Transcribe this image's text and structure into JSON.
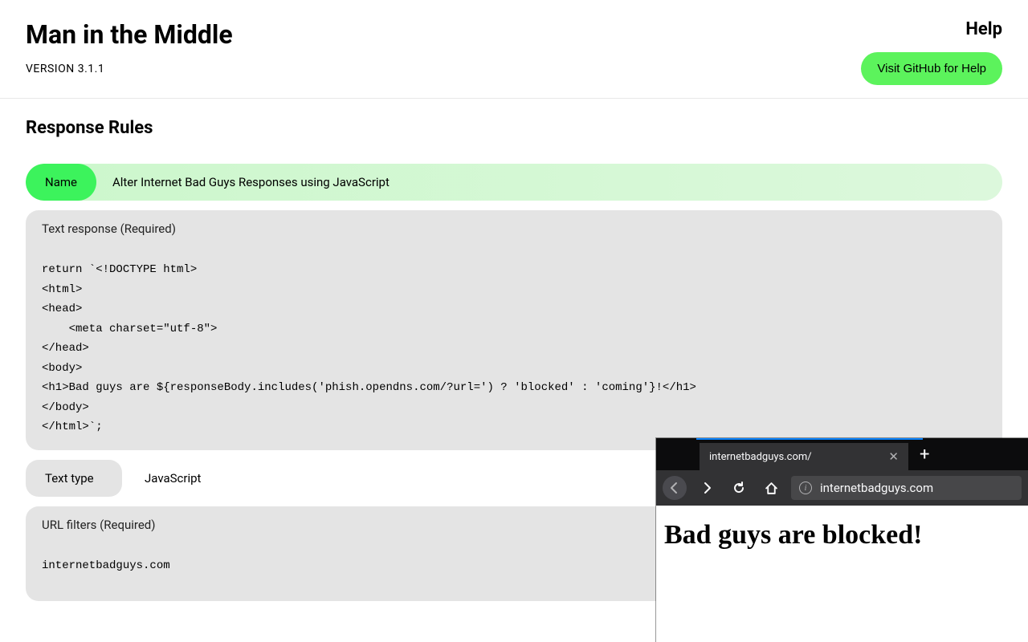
{
  "header": {
    "title": "Man in the Middle",
    "version": "VERSION 3.1.1",
    "help_title": "Help",
    "github_button": "Visit GitHub for Help"
  },
  "section": {
    "title": "Response Rules"
  },
  "rule": {
    "name_label": "Name",
    "name_value": "Alter Internet Bad Guys Responses using JavaScript",
    "text_response_label": "Text response (Required)",
    "text_response_value": "return `<!DOCTYPE html>\n<html>\n<head>\n    <meta charset=\"utf-8\">\n</head>\n<body>\n<h1>Bad guys are ${responseBody.includes('phish.opendns.com/?url=') ? 'blocked' : 'coming'}!</h1>\n</body>\n</html>`;",
    "text_type_label": "Text type",
    "text_type_value": "JavaScript",
    "url_filters_label": "URL filters (Required)",
    "url_filters_value": "internetbadguys.com"
  },
  "browser": {
    "tab_title": "internetbadguys.com/",
    "address": "internetbadguys.com",
    "page_heading": "Bad guys are blocked!"
  }
}
